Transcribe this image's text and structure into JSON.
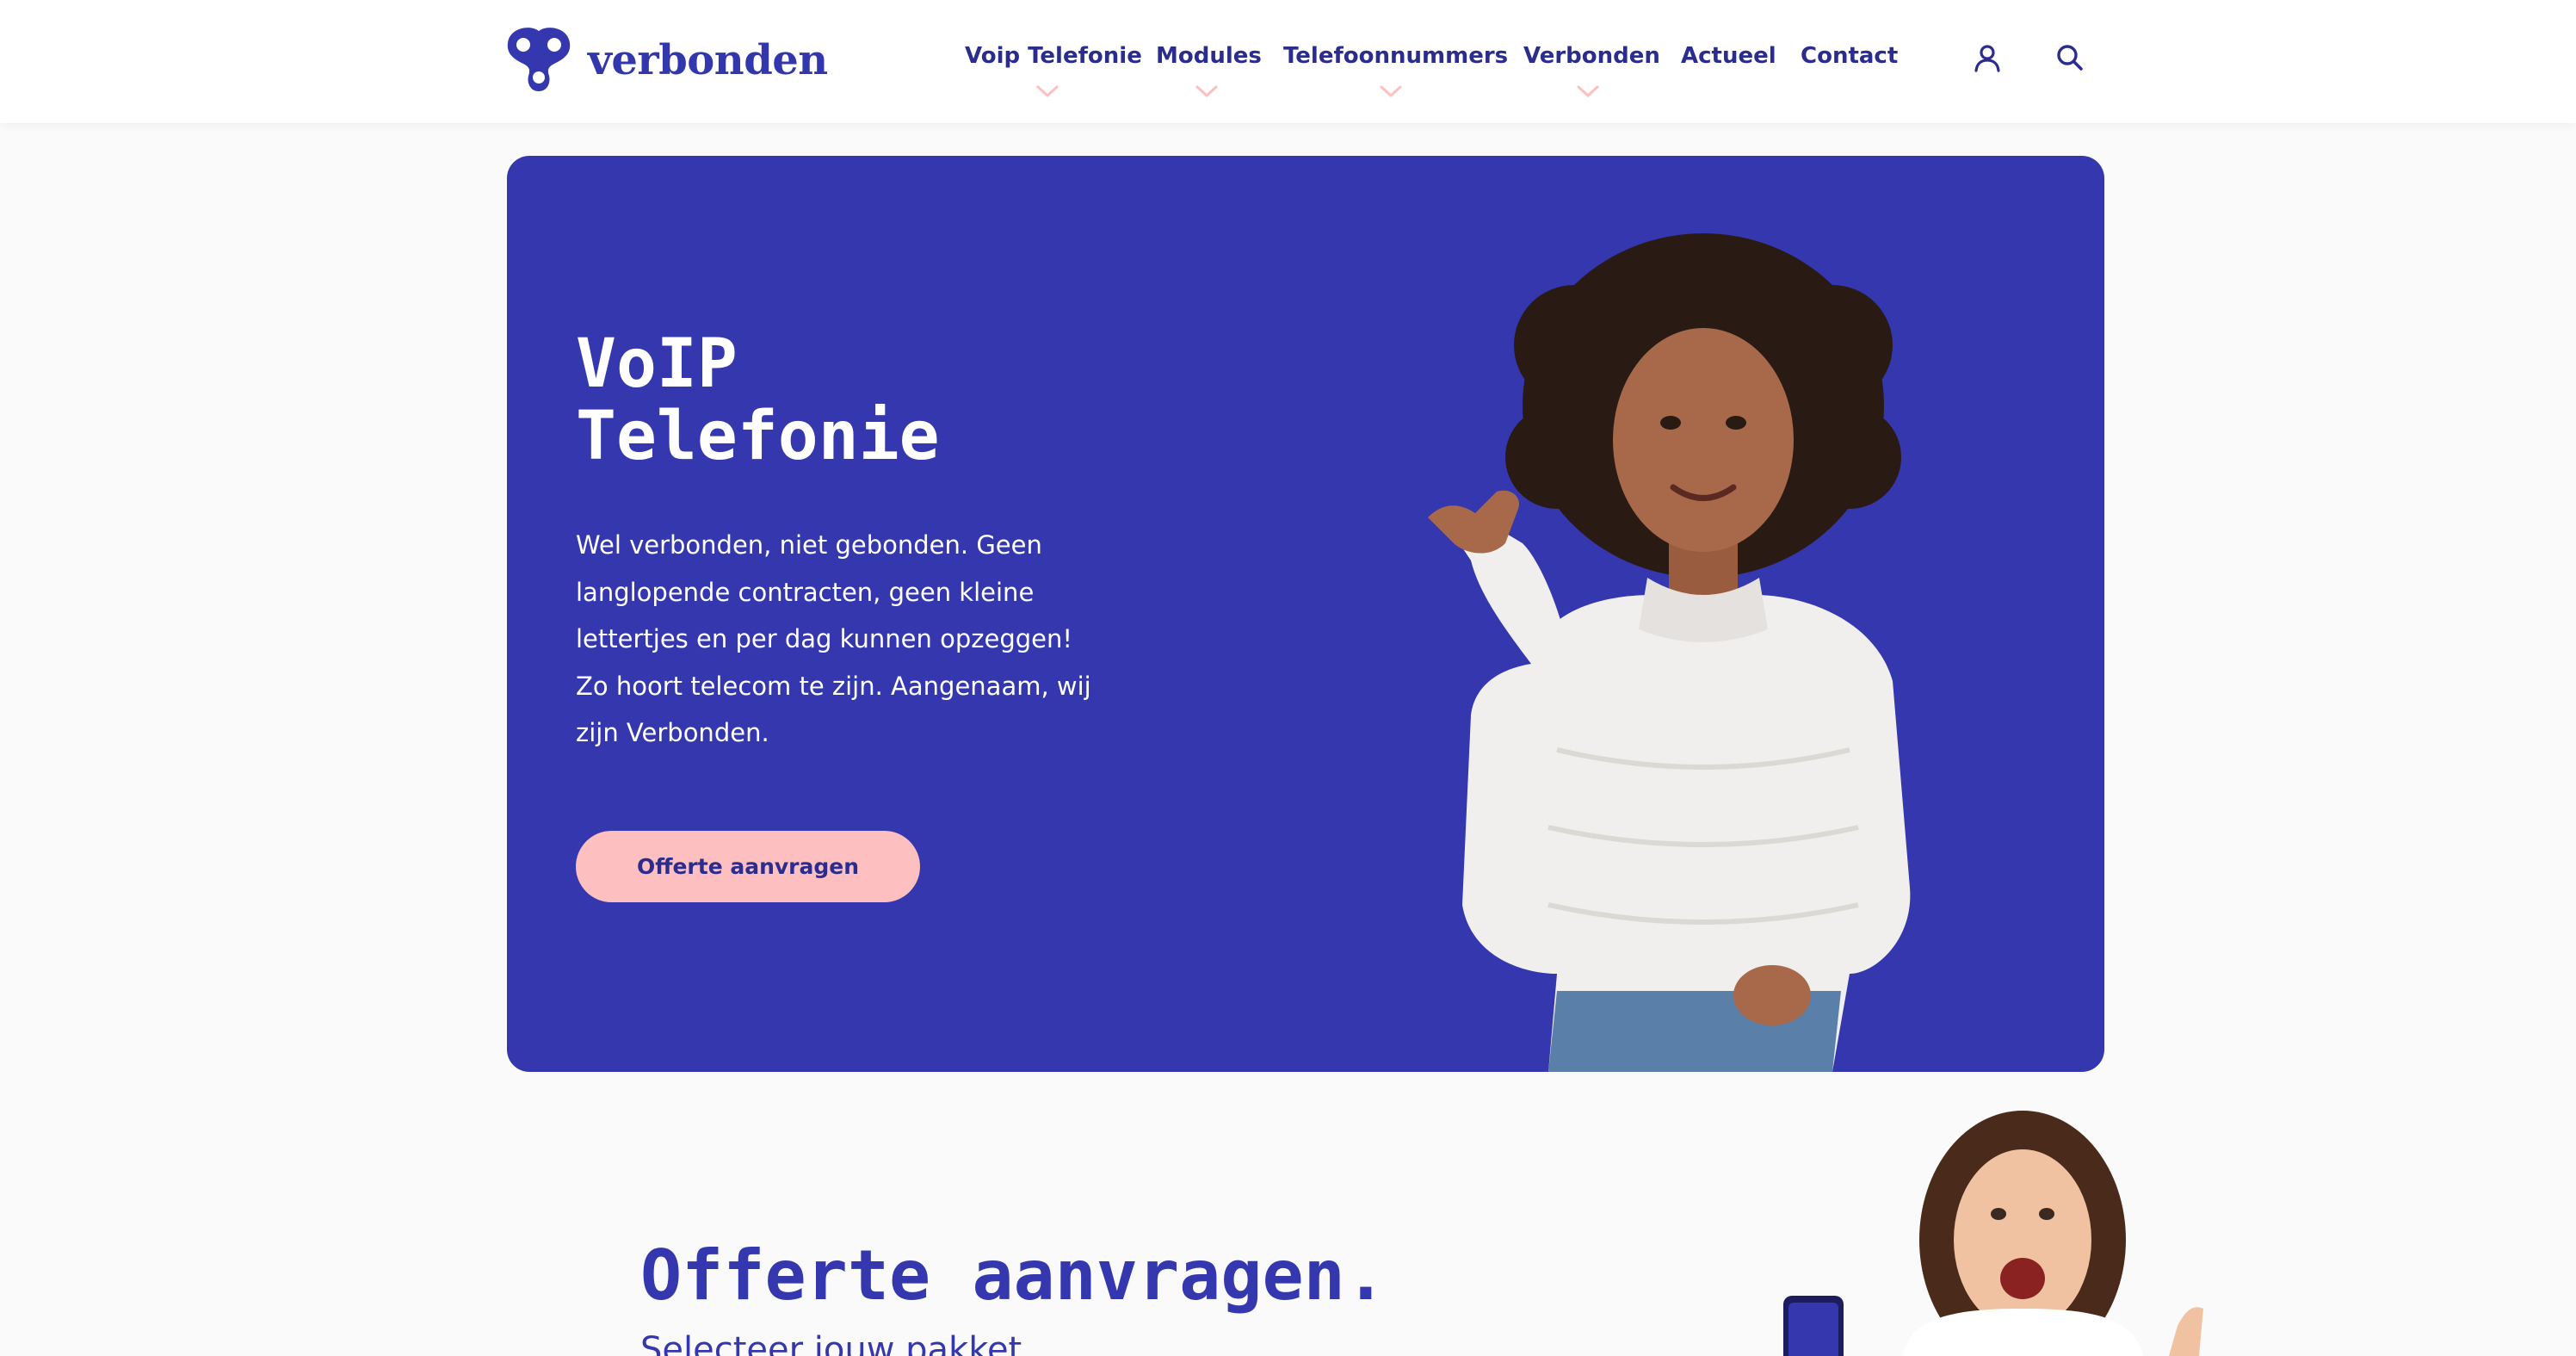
{
  "brand": {
    "name": "verbonden",
    "primary_color": "#3437ae",
    "accent_color": "#fdbfbf",
    "nav_text_color": "#2b2d8e"
  },
  "nav": {
    "items": [
      {
        "label": "Voip Telefonie",
        "has_dropdown": true
      },
      {
        "label": "Modules",
        "has_dropdown": true
      },
      {
        "label": "Telefoonnummers",
        "has_dropdown": true
      },
      {
        "label": "Verbonden",
        "has_dropdown": true
      },
      {
        "label": "Actueel",
        "has_dropdown": false
      },
      {
        "label": "Contact",
        "has_dropdown": false
      }
    ],
    "icons": [
      "user-icon",
      "search-icon"
    ]
  },
  "hero": {
    "title_line1": "VoIP",
    "title_line2": "Telefonie",
    "text": "Wel verbonden, niet gebonden. Geen langlopende contracten, geen kleine lettertjes en per dag kunnen opzeggen! Zo hoort telecom te zijn. Aangenaam, wij zijn Verbonden.",
    "button_label": "Offerte aanvragen"
  },
  "offerte": {
    "title": "Offerte aanvragen.",
    "subtitle": "Selecteer jouw pakket"
  }
}
